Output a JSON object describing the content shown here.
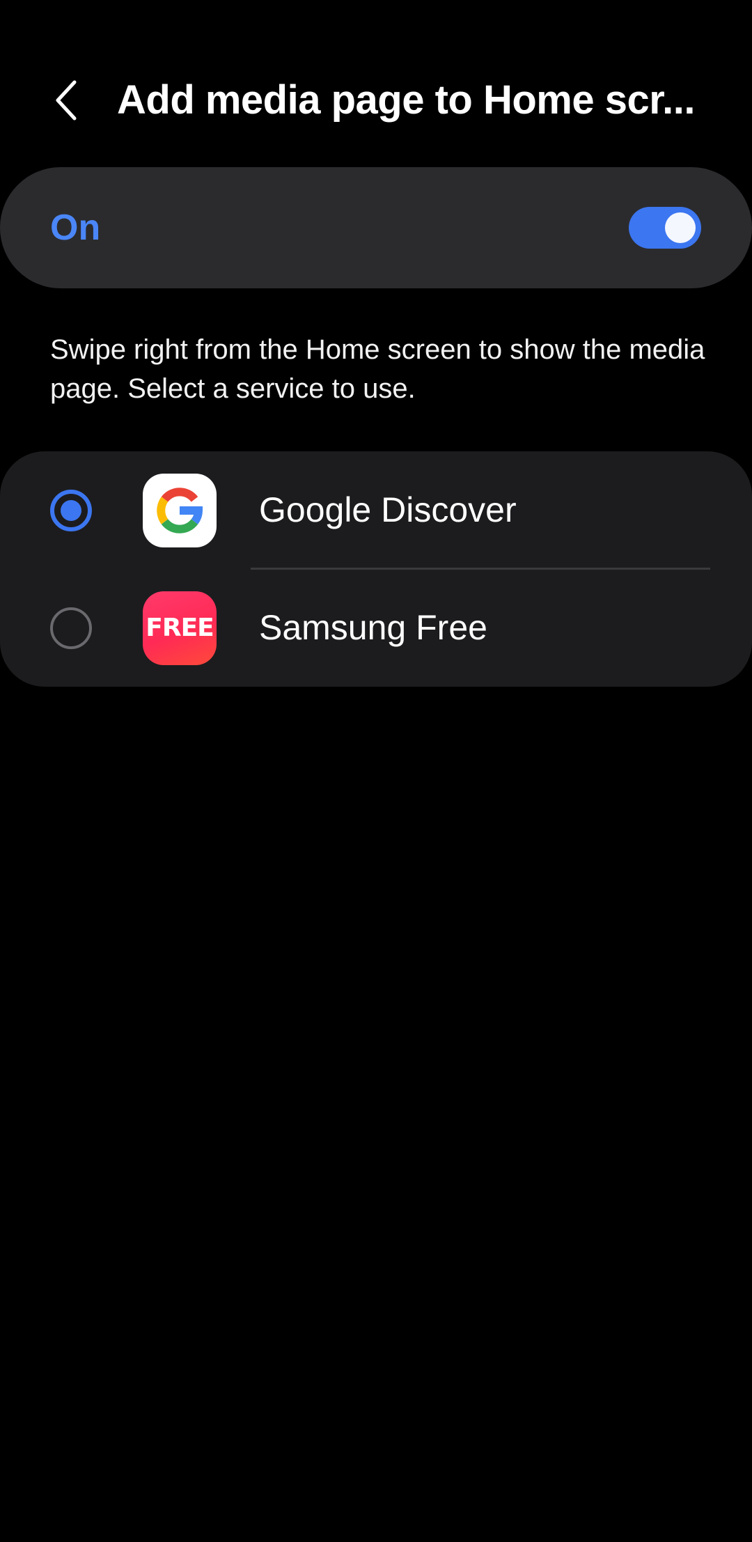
{
  "header": {
    "back_icon": "chevron-left-icon",
    "title": "Add media page to Home scr..."
  },
  "master_switch": {
    "label": "On",
    "checked": true,
    "accent_color": "#3c76f0",
    "label_color": "#4a86f7"
  },
  "description": "Swipe right from the Home screen to show the media page. Select a service to use.",
  "services": [
    {
      "label": "Google Discover",
      "icon": "google-icon",
      "selected": true
    },
    {
      "label": "Samsung Free",
      "icon": "samsung-free-icon",
      "icon_text": "FREE",
      "selected": false
    }
  ]
}
